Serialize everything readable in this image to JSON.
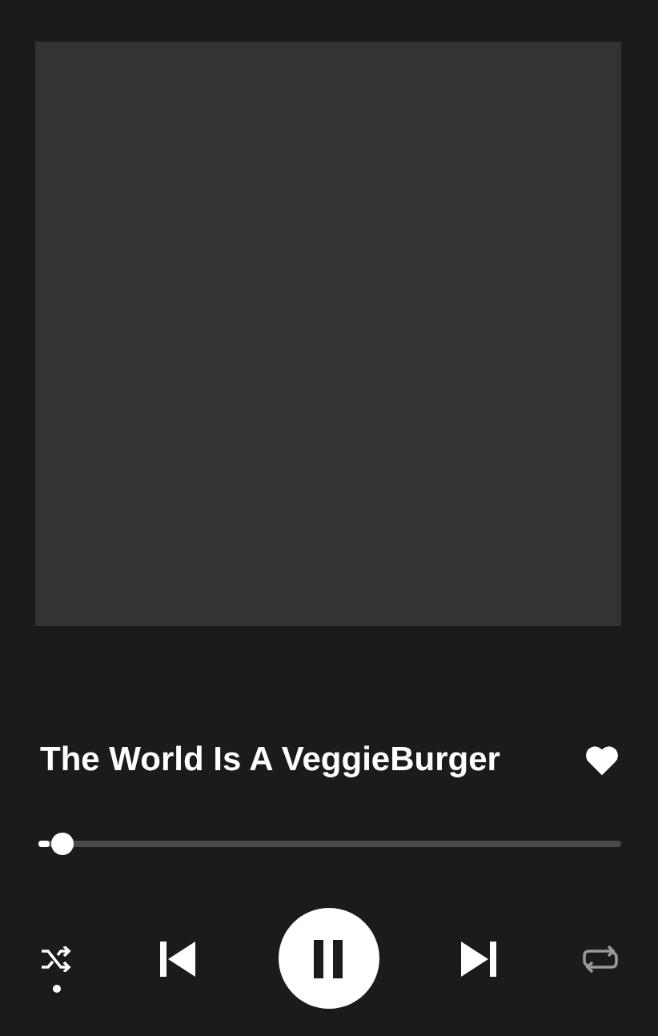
{
  "track": {
    "title": "The World Is A VeggieBurger",
    "liked": true
  },
  "progress": {
    "level": 0.02
  },
  "controls": {
    "shuffle": true,
    "playing": true,
    "repeat": false
  }
}
